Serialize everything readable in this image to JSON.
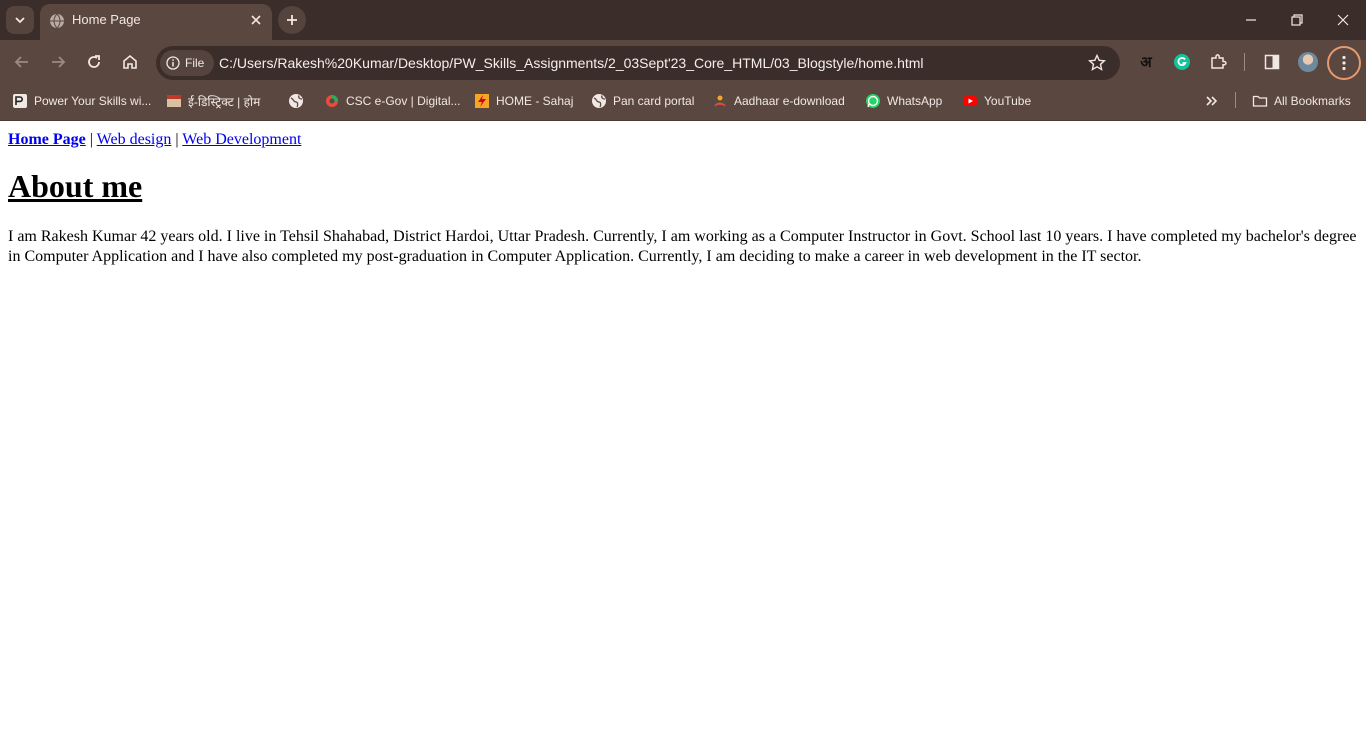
{
  "browser": {
    "tab": {
      "title": "Home Page"
    },
    "address": {
      "chip_label": "File",
      "url": "C:/Users/Rakesh%20Kumar/Desktop/PW_Skills_Assignments/2_03Sept'23_Core_HTML/03_Blogstyle/home.html"
    },
    "extensions": {
      "hindi_glyph": "अ"
    },
    "bookmarks": [
      {
        "label": "Power Your Skills wi...",
        "icon": "pw-icon"
      },
      {
        "label": "ई-डिस्ट्रिक्ट | होम",
        "icon": "edistrict-icon"
      },
      {
        "label": "",
        "icon": "globe-icon"
      },
      {
        "label": "CSC e-Gov | Digital...",
        "icon": "csc-icon"
      },
      {
        "label": "HOME - Sahaj",
        "icon": "sahaj-icon"
      },
      {
        "label": "Pan card portal",
        "icon": "globe-icon"
      },
      {
        "label": "Aadhaar e-download",
        "icon": "aadhaar-icon"
      },
      {
        "label": "WhatsApp",
        "icon": "whatsapp-icon"
      },
      {
        "label": "YouTube",
        "icon": "youtube-icon"
      }
    ],
    "all_bookmarks_label": "All Bookmarks",
    "colors": {
      "frame": "#3b2e2a",
      "toolbar": "#5a4740",
      "menu_ring": "#e89a6e",
      "link": "#0000ee"
    }
  },
  "page": {
    "nav": {
      "home": "Home Page",
      "sep1": " | ",
      "web_design": "Web design",
      "sep2": " | ",
      "web_development": "Web Development"
    },
    "heading": "About me",
    "paragraph": "I am Rakesh Kumar 42 years old. I live in Tehsil Shahabad, District Hardoi, Uttar Pradesh. Currently, I am working as a Computer Instructor in Govt. School last 10 years. I have completed my bachelor's degree in Computer Application and I have also completed my post-graduation in Computer Application. Currently, I am deciding to make a career in web development in the IT sector."
  }
}
